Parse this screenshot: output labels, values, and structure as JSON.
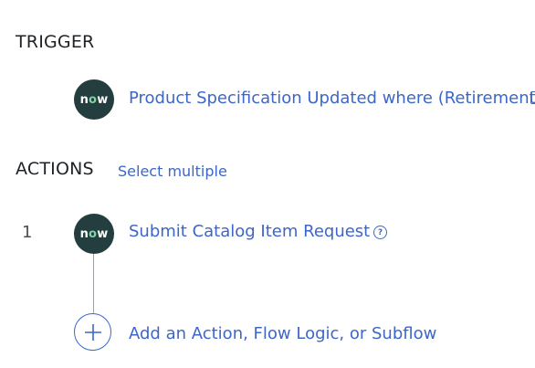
{
  "trigger": {
    "heading": "TRIGGER",
    "badge_text_n": "n",
    "badge_text_o": "o",
    "badge_text_w": "w",
    "link_text": "Product Specification Updated where (Retirement"
  },
  "actions": {
    "heading": "ACTIONS",
    "select_multiple": "Select multiple",
    "items": [
      {
        "number": "1",
        "badge_text_n": "n",
        "badge_text_o": "o",
        "badge_text_w": "w",
        "label": "Submit Catalog Item Request",
        "help_glyph": "?"
      }
    ],
    "add_label": "Add an Action, Flow Logic, or Subflow"
  },
  "colors": {
    "link": "#3d66c9",
    "badge_bg": "#243d3e",
    "badge_o": "#7fd3a5",
    "heading": "#1f2326"
  },
  "icons": [
    "now-logo-icon",
    "help-circle-icon",
    "plus-icon",
    "truncated-icon"
  ]
}
